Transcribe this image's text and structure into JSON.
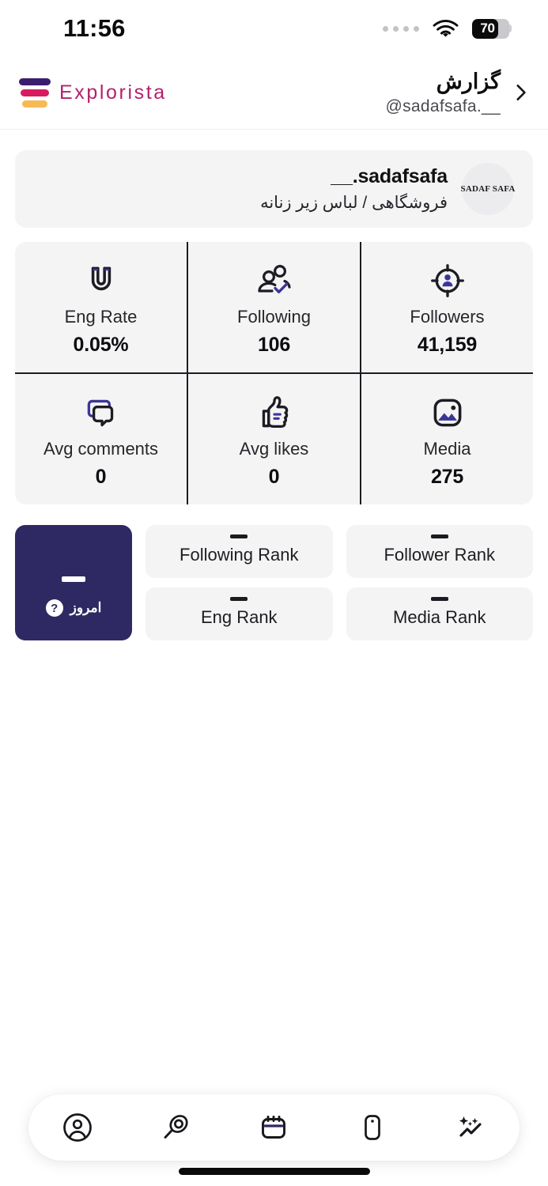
{
  "status_bar": {
    "time": "11:56",
    "battery_percent": "70",
    "battery_level": 70,
    "signal_icon": "signal-dots-icon",
    "wifi_icon": "wifi-icon"
  },
  "header": {
    "brand_name": "Explorista",
    "brand_logo_icon": "explorista-logo-icon",
    "title": "گزارش",
    "subtitle": "@sadafsafa.__",
    "chevron_icon": "chevron-right-icon"
  },
  "profile": {
    "handle": "__.sadafsafa",
    "bio": "فروشگاهی / لباس زیر زنانه",
    "avatar_text": "SADAF SAFA"
  },
  "stats": [
    {
      "label": "Eng Rate",
      "value": "0.05%",
      "icon": "magnet-icon"
    },
    {
      "label": "Following",
      "value": "106",
      "icon": "users-check-icon"
    },
    {
      "label": "Followers",
      "value": "41,159",
      "icon": "target-person-icon"
    },
    {
      "label": "Avg comments",
      "value": "0",
      "icon": "chat-bubbles-icon"
    },
    {
      "label": "Avg likes",
      "value": "0",
      "icon": "thumbs-up-icon"
    },
    {
      "label": "Media",
      "value": "275",
      "icon": "image-icon"
    }
  ],
  "today_card": {
    "value": "–",
    "label": "امروز",
    "help_icon": "question-mark-icon"
  },
  "ranks": [
    {
      "label": "Following Rank",
      "value": "–"
    },
    {
      "label": "Follower Rank",
      "value": "–"
    },
    {
      "label": "Eng Rank",
      "value": "–"
    },
    {
      "label": "Media Rank",
      "value": "–"
    }
  ],
  "bottom_nav": [
    {
      "name": "profile",
      "icon": "user-circle-icon",
      "selected": false
    },
    {
      "name": "search",
      "icon": "magnifier-icon",
      "selected": false
    },
    {
      "name": "calendar",
      "icon": "calendar-icon",
      "selected": true
    },
    {
      "name": "device",
      "icon": "phone-icon",
      "selected": false
    },
    {
      "name": "analytics",
      "icon": "sparkle-chart-icon",
      "selected": false
    }
  ],
  "colors": {
    "accent_purple": "#2e2963",
    "brand_pink": "#b3216b",
    "brand_orange": "#f7b955",
    "card_grey": "#f4f4f5",
    "ink": "#1c1c22"
  }
}
